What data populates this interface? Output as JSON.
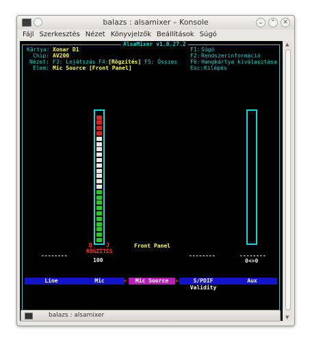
{
  "window": {
    "title": "balazs : alsamixer – Konsole",
    "buttons": [
      "⌄",
      "⌃",
      "✕"
    ]
  },
  "menu": [
    "Fájl",
    "Szerkesztés",
    "Nézet",
    "Könyvjelzők",
    "Beállítások",
    "Súgó"
  ],
  "mixer": {
    "frame_title": "AlsaMixer v1.0.27.2",
    "info": {
      "card_key": "Kártya:",
      "card_val": "Xonar D1",
      "chip_key": "Chip:",
      "chip_val": "AV200",
      "view_key": "Nézet:",
      "view_f3": "F3: Lejátszás",
      "view_f4_key": "F4:",
      "view_f4_val": "[Rögzítés]",
      "view_f5": "F5: Összes",
      "item_key": "Elem:",
      "item_val": "Mic Source [Front Panel]"
    },
    "help": [
      {
        "key": "F1:",
        "val": "Súgó"
      },
      {
        "key": "F2:",
        "val": "Rendszerinformáció"
      },
      {
        "key": "F6:",
        "val": "Hangkártya kiválasztása"
      },
      {
        "key": "Esc:",
        "val": "Kilépés"
      }
    ],
    "channels": [
      {
        "label": "Line",
        "value_text": "--------",
        "level": null
      },
      {
        "label": "Mic",
        "bl": "B",
        "br": "J",
        "capture": "RÖGZÍTÉS",
        "volume": "100",
        "level": 1.0
      },
      {
        "label": "Mic Source",
        "selected": true,
        "enum_value": "Front Panel",
        "left_arrow": "<",
        "right_arrow": ">"
      },
      {
        "label": "S/PDIF Validity",
        "value_text": "--------"
      },
      {
        "label": "Aux",
        "value_text": "--------",
        "volume": "0<>0",
        "level": 0.0
      }
    ]
  },
  "taskbar": {
    "task": "balazs : alsamixer"
  },
  "colors": {
    "cyan": "#1bd7d7",
    "yellow": "#ffff40",
    "red": "#ff3030",
    "label_bg": "#1414c8",
    "selected_bg": "#b81fb8"
  }
}
